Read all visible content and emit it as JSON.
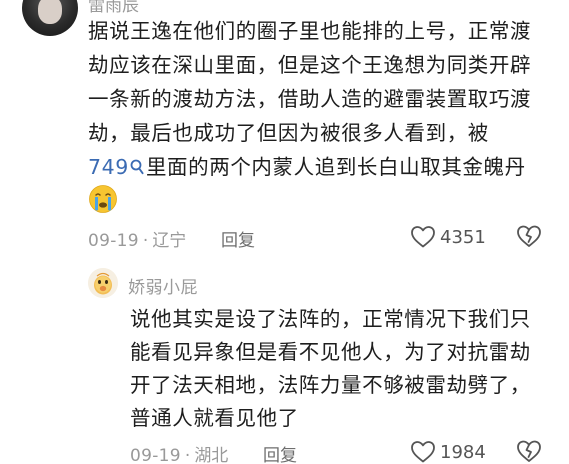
{
  "comment": {
    "username": "雷雨辰",
    "lines": [
      "据说王逸在他们的圈子里也能排的上号，正常渡",
      "劫应该在深山里面，但是这个王逸想为同类开辟",
      "一条新的渡劫方法，借助人造的避雷装置取巧渡",
      "劫，最后也成功了但因为被很多人看到，被"
    ],
    "mention_number": "749",
    "last_line_rest": "里面的两个内蒙人追到长白山取其金魄丹",
    "emoji": "crying-face",
    "date": "09-19",
    "location": "辽宁",
    "reply_label": "回复",
    "likes": "4351"
  },
  "reply": {
    "username": "娇弱小屁",
    "lines": [
      "说他其实是设了法阵的，正常情况下我们只",
      "能看见异象但是看不见他人，为了对抗雷劫",
      "开了法天相地，法阵力量不够被雷劫劈了，",
      "普通人就看见他了"
    ],
    "date": "09-19",
    "location": "湖北",
    "reply_label": "回复",
    "likes": "1984"
  },
  "colors": {
    "text": "#1e1e1e",
    "meta": "#999999",
    "mention": "#3b6bb3"
  }
}
